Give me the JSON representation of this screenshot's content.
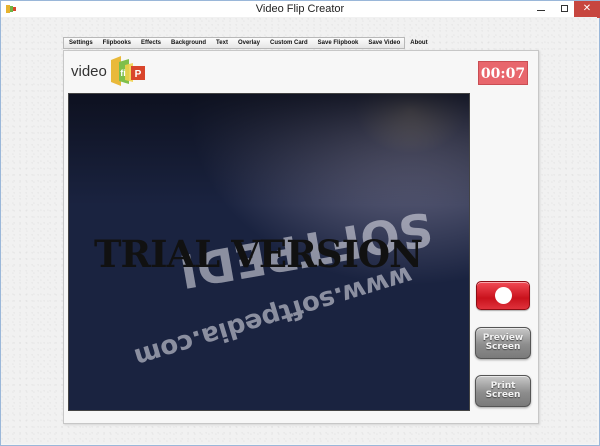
{
  "window": {
    "title": "Video Flip Creator",
    "close_glyph": "✕"
  },
  "menu": {
    "items": [
      "Settings",
      "Flipbooks",
      "Effects",
      "Background",
      "Text",
      "Overlay",
      "Custom Card",
      "Save Flipbook",
      "Save Video",
      "About"
    ]
  },
  "logo": {
    "text": "video",
    "flip_icon": "flip-logo-icon"
  },
  "timer": {
    "value": "00:07",
    "color": "#e8666c"
  },
  "preview": {
    "watermark": "TRIAL VERSION"
  },
  "buttons": {
    "record_icon": "record-dot-icon",
    "record_color": "#d71f2a",
    "preview_line1": "Preview",
    "preview_line2": "Screen",
    "print_line1": "Print",
    "print_line2": "Screen"
  }
}
